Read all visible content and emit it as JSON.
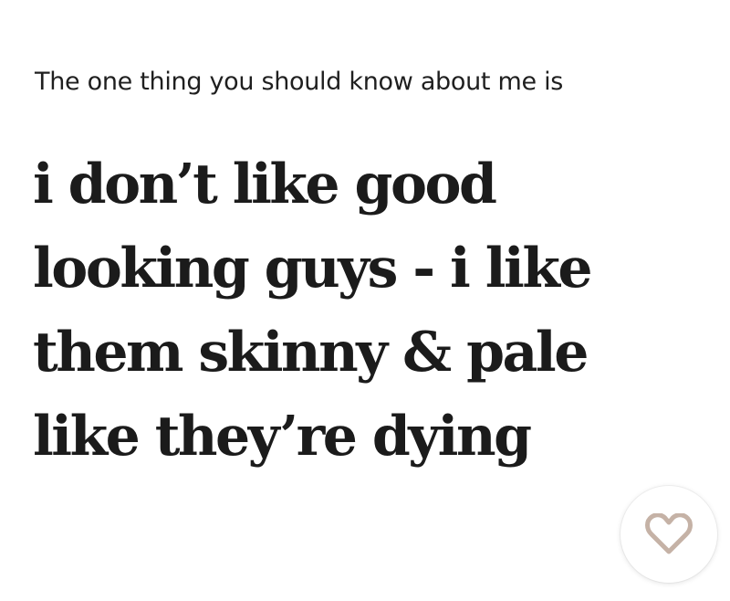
{
  "prompt": {
    "text": "The one thing you should know about me is"
  },
  "answer": {
    "lines": [
      "i don’t like good",
      "looking guys - i like",
      "them skinny & pale",
      "like they’re dying"
    ]
  },
  "like_button": {
    "icon": "heart-icon",
    "color": "#c5b2a6"
  }
}
